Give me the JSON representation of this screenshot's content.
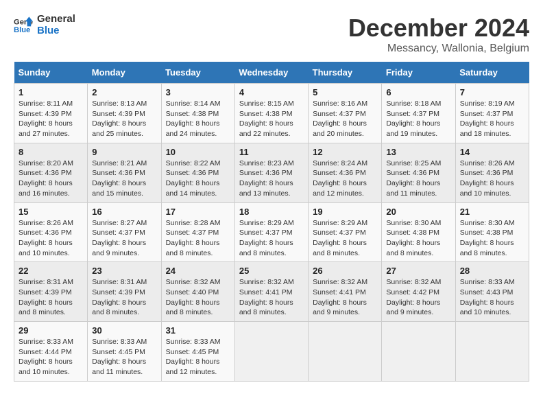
{
  "header": {
    "logo_line1": "General",
    "logo_line2": "Blue",
    "title": "December 2024",
    "subtitle": "Messancy, Wallonia, Belgium"
  },
  "weekdays": [
    "Sunday",
    "Monday",
    "Tuesday",
    "Wednesday",
    "Thursday",
    "Friday",
    "Saturday"
  ],
  "weeks": [
    [
      {
        "day": "1",
        "sunrise": "Sunrise: 8:11 AM",
        "sunset": "Sunset: 4:39 PM",
        "daylight": "Daylight: 8 hours and 27 minutes."
      },
      {
        "day": "2",
        "sunrise": "Sunrise: 8:13 AM",
        "sunset": "Sunset: 4:39 PM",
        "daylight": "Daylight: 8 hours and 25 minutes."
      },
      {
        "day": "3",
        "sunrise": "Sunrise: 8:14 AM",
        "sunset": "Sunset: 4:38 PM",
        "daylight": "Daylight: 8 hours and 24 minutes."
      },
      {
        "day": "4",
        "sunrise": "Sunrise: 8:15 AM",
        "sunset": "Sunset: 4:38 PM",
        "daylight": "Daylight: 8 hours and 22 minutes."
      },
      {
        "day": "5",
        "sunrise": "Sunrise: 8:16 AM",
        "sunset": "Sunset: 4:37 PM",
        "daylight": "Daylight: 8 hours and 20 minutes."
      },
      {
        "day": "6",
        "sunrise": "Sunrise: 8:18 AM",
        "sunset": "Sunset: 4:37 PM",
        "daylight": "Daylight: 8 hours and 19 minutes."
      },
      {
        "day": "7",
        "sunrise": "Sunrise: 8:19 AM",
        "sunset": "Sunset: 4:37 PM",
        "daylight": "Daylight: 8 hours and 18 minutes."
      }
    ],
    [
      {
        "day": "8",
        "sunrise": "Sunrise: 8:20 AM",
        "sunset": "Sunset: 4:36 PM",
        "daylight": "Daylight: 8 hours and 16 minutes."
      },
      {
        "day": "9",
        "sunrise": "Sunrise: 8:21 AM",
        "sunset": "Sunset: 4:36 PM",
        "daylight": "Daylight: 8 hours and 15 minutes."
      },
      {
        "day": "10",
        "sunrise": "Sunrise: 8:22 AM",
        "sunset": "Sunset: 4:36 PM",
        "daylight": "Daylight: 8 hours and 14 minutes."
      },
      {
        "day": "11",
        "sunrise": "Sunrise: 8:23 AM",
        "sunset": "Sunset: 4:36 PM",
        "daylight": "Daylight: 8 hours and 13 minutes."
      },
      {
        "day": "12",
        "sunrise": "Sunrise: 8:24 AM",
        "sunset": "Sunset: 4:36 PM",
        "daylight": "Daylight: 8 hours and 12 minutes."
      },
      {
        "day": "13",
        "sunrise": "Sunrise: 8:25 AM",
        "sunset": "Sunset: 4:36 PM",
        "daylight": "Daylight: 8 hours and 11 minutes."
      },
      {
        "day": "14",
        "sunrise": "Sunrise: 8:26 AM",
        "sunset": "Sunset: 4:36 PM",
        "daylight": "Daylight: 8 hours and 10 minutes."
      }
    ],
    [
      {
        "day": "15",
        "sunrise": "Sunrise: 8:26 AM",
        "sunset": "Sunset: 4:36 PM",
        "daylight": "Daylight: 8 hours and 10 minutes."
      },
      {
        "day": "16",
        "sunrise": "Sunrise: 8:27 AM",
        "sunset": "Sunset: 4:37 PM",
        "daylight": "Daylight: 8 hours and 9 minutes."
      },
      {
        "day": "17",
        "sunrise": "Sunrise: 8:28 AM",
        "sunset": "Sunset: 4:37 PM",
        "daylight": "Daylight: 8 hours and 8 minutes."
      },
      {
        "day": "18",
        "sunrise": "Sunrise: 8:29 AM",
        "sunset": "Sunset: 4:37 PM",
        "daylight": "Daylight: 8 hours and 8 minutes."
      },
      {
        "day": "19",
        "sunrise": "Sunrise: 8:29 AM",
        "sunset": "Sunset: 4:37 PM",
        "daylight": "Daylight: 8 hours and 8 minutes."
      },
      {
        "day": "20",
        "sunrise": "Sunrise: 8:30 AM",
        "sunset": "Sunset: 4:38 PM",
        "daylight": "Daylight: 8 hours and 8 minutes."
      },
      {
        "day": "21",
        "sunrise": "Sunrise: 8:30 AM",
        "sunset": "Sunset: 4:38 PM",
        "daylight": "Daylight: 8 hours and 8 minutes."
      }
    ],
    [
      {
        "day": "22",
        "sunrise": "Sunrise: 8:31 AM",
        "sunset": "Sunset: 4:39 PM",
        "daylight": "Daylight: 8 hours and 8 minutes."
      },
      {
        "day": "23",
        "sunrise": "Sunrise: 8:31 AM",
        "sunset": "Sunset: 4:39 PM",
        "daylight": "Daylight: 8 hours and 8 minutes."
      },
      {
        "day": "24",
        "sunrise": "Sunrise: 8:32 AM",
        "sunset": "Sunset: 4:40 PM",
        "daylight": "Daylight: 8 hours and 8 minutes."
      },
      {
        "day": "25",
        "sunrise": "Sunrise: 8:32 AM",
        "sunset": "Sunset: 4:41 PM",
        "daylight": "Daylight: 8 hours and 8 minutes."
      },
      {
        "day": "26",
        "sunrise": "Sunrise: 8:32 AM",
        "sunset": "Sunset: 4:41 PM",
        "daylight": "Daylight: 8 hours and 9 minutes."
      },
      {
        "day": "27",
        "sunrise": "Sunrise: 8:32 AM",
        "sunset": "Sunset: 4:42 PM",
        "daylight": "Daylight: 8 hours and 9 minutes."
      },
      {
        "day": "28",
        "sunrise": "Sunrise: 8:33 AM",
        "sunset": "Sunset: 4:43 PM",
        "daylight": "Daylight: 8 hours and 10 minutes."
      }
    ],
    [
      {
        "day": "29",
        "sunrise": "Sunrise: 8:33 AM",
        "sunset": "Sunset: 4:44 PM",
        "daylight": "Daylight: 8 hours and 10 minutes."
      },
      {
        "day": "30",
        "sunrise": "Sunrise: 8:33 AM",
        "sunset": "Sunset: 4:45 PM",
        "daylight": "Daylight: 8 hours and 11 minutes."
      },
      {
        "day": "31",
        "sunrise": "Sunrise: 8:33 AM",
        "sunset": "Sunset: 4:45 PM",
        "daylight": "Daylight: 8 hours and 12 minutes."
      },
      null,
      null,
      null,
      null
    ]
  ]
}
